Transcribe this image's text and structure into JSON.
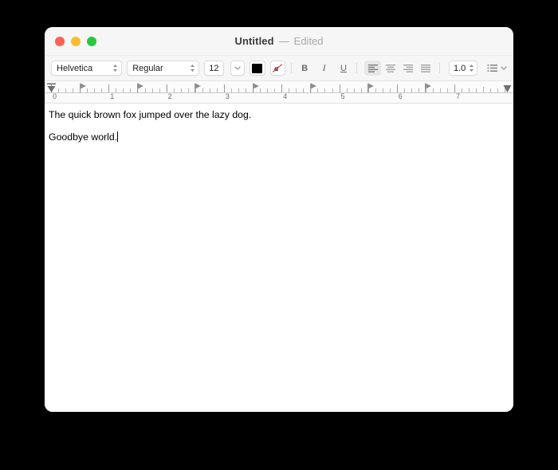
{
  "window": {
    "title": "Untitled",
    "title_dash": "—",
    "status": "Edited",
    "controls": {
      "close": "close-button",
      "minimize": "minimize-button",
      "maximize": "maximize-button"
    },
    "colors": {
      "close": "#ff5f57",
      "minimize": "#febc2e",
      "maximize": "#28c840",
      "toolbar_bg": "#f6f6f6",
      "page_bg": "#ffffff",
      "desktop_bg": "#000000",
      "text": "#000000",
      "accent_strike": "#e0262b"
    }
  },
  "toolbar": {
    "font_family": "Helvetica",
    "font_style": "Regular",
    "font_size": "12",
    "text_color": "#000000",
    "bold_label": "B",
    "italic_label": "I",
    "underline_label": "U",
    "alignments": [
      {
        "name": "align-left",
        "active": true
      },
      {
        "name": "align-center",
        "active": false
      },
      {
        "name": "align-right",
        "active": false
      },
      {
        "name": "align-justify",
        "active": false
      }
    ],
    "line_spacing": "1.0",
    "list_style": "bulleted-list"
  },
  "ruler": {
    "unit": "inches",
    "numbers": [
      "0",
      "1",
      "2",
      "3",
      "4",
      "5",
      "6",
      "7"
    ],
    "tab_stops": [
      "0.5",
      "1.5",
      "2.5",
      "3.5",
      "4.5",
      "5.5",
      "6.5"
    ],
    "left_margin": "0",
    "right_margin": "8"
  },
  "document": {
    "lines": [
      "The quick brown fox jumped over the lazy dog.",
      "Goodbye world."
    ]
  }
}
